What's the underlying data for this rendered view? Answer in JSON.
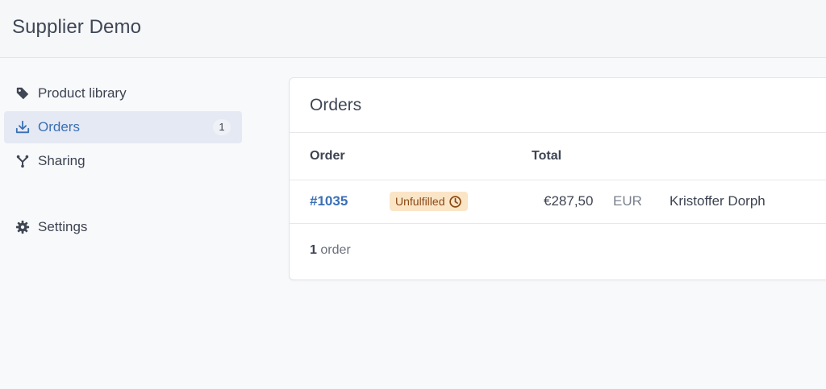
{
  "app": {
    "title": "Supplier Demo"
  },
  "sidebar": {
    "items": [
      {
        "label": "Product library",
        "icon": "tag-icon"
      },
      {
        "label": "Orders",
        "icon": "download-icon",
        "badge": "1",
        "active": true
      },
      {
        "label": "Sharing",
        "icon": "share-icon"
      }
    ],
    "settings": {
      "label": "Settings",
      "icon": "gear-icon"
    }
  },
  "orders": {
    "title": "Orders",
    "columns": {
      "order": "Order",
      "total": "Total"
    },
    "rows": [
      {
        "order_number": "#1035",
        "status": "Unfulfilled",
        "total": "€287,50",
        "currency": "EUR",
        "customer": "Kristoffer Dorph"
      }
    ],
    "footer": {
      "count": "1",
      "unit": "order"
    }
  },
  "colors": {
    "accent": "#3a6fb5",
    "active_bg": "#e4e9f3",
    "status_bg": "#fbe5c7",
    "status_text": "#8a4a14"
  }
}
